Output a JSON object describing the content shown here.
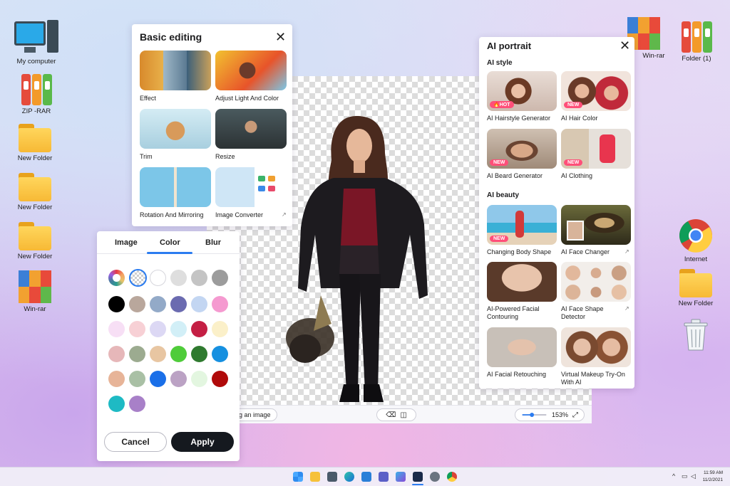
{
  "desktop": {
    "left_icons": [
      {
        "label": "My computer"
      },
      {
        "label": "ZIP -RAR"
      },
      {
        "label": "New Folder"
      },
      {
        "label": "New Folder"
      },
      {
        "label": "New Folder"
      },
      {
        "label": "Win-rar"
      }
    ],
    "right_icons": [
      {
        "label": "Win-rar"
      },
      {
        "label": "Folder (1)"
      },
      {
        "label": "Internet"
      },
      {
        "label": "New Folder"
      }
    ]
  },
  "basic_editing": {
    "title": "Basic editing",
    "items": [
      {
        "label": "Effect"
      },
      {
        "label": "Adjust Light And Color"
      },
      {
        "label": "Trim"
      },
      {
        "label": "Resize"
      },
      {
        "label": "Rotation And Mirroring"
      },
      {
        "label": "Image Converter"
      }
    ]
  },
  "ai_portrait": {
    "title": "AI portrait",
    "style_heading": "AI style",
    "beauty_heading": "AI beauty",
    "style_items": [
      {
        "label": "AI Hairstyle Generator",
        "badge": "HOT"
      },
      {
        "label": "AI Hair Color",
        "badge": "NEW"
      },
      {
        "label": "AI Beard Generator",
        "badge": "NEW"
      },
      {
        "label": "AI Clothing",
        "badge": "NEW"
      }
    ],
    "beauty_items": [
      {
        "label": "Changing Body Shape",
        "badge": "NEW"
      },
      {
        "label": "AI Face Changer"
      },
      {
        "label": "AI-Powered Facial Contouring"
      },
      {
        "label": "AI Face Shape Detector"
      },
      {
        "label": "AI Facial Retouching"
      },
      {
        "label": "Virtual Makeup Try-On With AI"
      }
    ]
  },
  "background_panel": {
    "tabs": [
      "Image",
      "Color",
      "Blur"
    ],
    "active_tab": "Color",
    "swatches": [
      "#000000",
      "#b9a79c",
      "#93aac8",
      "#6b6bb0",
      "#c3d6f2",
      "#f59ad0",
      "#f7dff5",
      "#f7d0d5",
      "#dcd8f4",
      "#d2eff7",
      "#c41f44",
      "#fbf0c9",
      "#e6b7b9",
      "#9cab90",
      "#e8c6a2",
      "#4fcc3a",
      "#2f7a2f",
      "#1690e0",
      "#e7b498",
      "#a9c0a5",
      "#1a6fe8",
      "#bba2c4",
      "#e3f6e0",
      "#b00a0a",
      "#1ebac4",
      "#a880c8"
    ],
    "cancel_label": "Cancel",
    "apply_label": "Apply"
  },
  "canvas_toolbar": {
    "left_text": "ding an image",
    "zoom": "153%"
  },
  "taskbar": {
    "time": "11:59 AM",
    "date": "11/2/2021"
  }
}
